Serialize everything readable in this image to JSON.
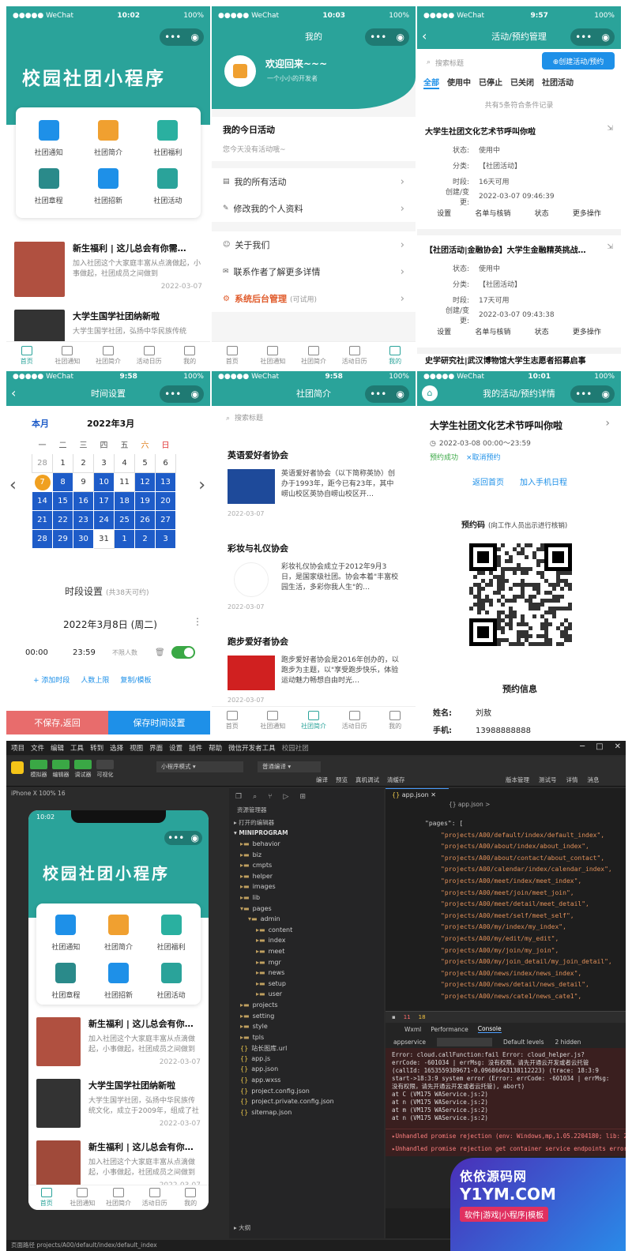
{
  "colors": {
    "teal": "#2aa39a",
    "blue": "#1e5cc8",
    "red": "#e05a5a"
  },
  "status": {
    "carrier": "●●●●● WeChat",
    "time1": "10:02",
    "time2": "10:03",
    "time3": "9:57",
    "time4": "9:58",
    "time5": "10:01",
    "battery": "100%"
  },
  "home": {
    "banner": "校园社团小程序",
    "grid": [
      {
        "label": "社团通知",
        "icon": "speaker-icon"
      },
      {
        "label": "社团简介",
        "icon": "book-icon"
      },
      {
        "label": "社团福利",
        "icon": "gift-icon"
      },
      {
        "label": "社团章程",
        "icon": "layers-icon"
      },
      {
        "label": "社团招新",
        "icon": "recruit-icon"
      },
      {
        "label": "社团活动",
        "icon": "flag-icon"
      }
    ],
    "news": [
      {
        "title": "新生福利 | 这儿总会有你需…",
        "desc": "加入社团这个大家庭丰富从点滴做起，小事做起，社团成员之间做到",
        "date": "2022-03-07"
      },
      {
        "title": "大学生国学社团纳新啦",
        "desc": "大学生国学社团，弘扬中华民族传统",
        "date": ""
      }
    ],
    "tabs": [
      "首页",
      "社团通知",
      "社团简介",
      "活动日历",
      "我的"
    ]
  },
  "me": {
    "title": "我的",
    "welcome": "欢迎回来~~~",
    "sub": "一个小小的开发者",
    "today_title": "我的今日活动",
    "today_empty": "您今天没有活动哦~",
    "menu1": [
      "我的所有活动",
      "修改我的个人资料"
    ],
    "menu2": [
      "关于我们",
      "联系作者了解更多详情"
    ],
    "admin": "系统后台管理",
    "admin_note": "(可试用)"
  },
  "manage": {
    "title": "活动/预约管理",
    "search": "搜索标题",
    "create": "⊕创建活动/预约",
    "filters": [
      "全部",
      "使用中",
      "已停止",
      "已关闭",
      "社团活动"
    ],
    "count": "共有5条符合条件记录",
    "cards": [
      {
        "title": "大学生社团文化艺术节呼叫你啦",
        "kv": [
          [
            "状态:",
            "使用中"
          ],
          [
            "分类:",
            "【社团活动】"
          ],
          [
            "时段:",
            "16天可用"
          ],
          [
            "创建/变更:",
            "2022-03-07 09:46:39"
          ]
        ]
      },
      {
        "title": "【社团活动|金融协会】大学生金融精英挑战…",
        "kv": [
          [
            "状态:",
            "使用中"
          ],
          [
            "分类:",
            "【社团活动】"
          ],
          [
            "时段:",
            "17天可用"
          ],
          [
            "创建/变更:",
            "2022-03-07 09:43:38"
          ]
        ]
      }
    ],
    "ops": [
      "设置",
      "名单与核销",
      "状态",
      "更多操作"
    ],
    "third": "史学研究社|武汉博物馆大学生志愿者招募启事"
  },
  "timeset": {
    "title": "时间设置",
    "month_tab": "本月",
    "month": "2022年3月",
    "week": [
      "一",
      "二",
      "三",
      "四",
      "五",
      "六",
      "日"
    ],
    "rows": [
      [
        "28",
        "1",
        "2",
        "3",
        "4",
        "5",
        "6"
      ],
      [
        "7",
        "8",
        "9",
        "10",
        "11",
        "12",
        "13"
      ],
      [
        "14",
        "15",
        "16",
        "17",
        "18",
        "19",
        "20"
      ],
      [
        "21",
        "22",
        "23",
        "24",
        "25",
        "26",
        "27"
      ],
      [
        "28",
        "29",
        "30",
        "31",
        "1",
        "2",
        "3"
      ]
    ],
    "period_title": "时段设置",
    "period_note": "(共38天可约)",
    "date": "2022年3月8日 (周二)",
    "start": "00:00",
    "end": "23:59",
    "limit": "不限人数",
    "actions": [
      "+ 添加时段",
      "人数上限",
      "复制/模板"
    ],
    "cancel": "不保存,返回",
    "save": "保存时间设置"
  },
  "clubs": {
    "title": "社团简介",
    "search": "搜索标题",
    "items": [
      {
        "name": "英语爱好者协会",
        "desc": "英语爱好者协会（以下简称英协）创办于1993年，距今已有23年，其中崂山校区英协自崂山校区开…",
        "date": "2022-03-07"
      },
      {
        "name": "彩妆与礼仪协会",
        "desc": "彩妆礼仪协会成立于2012年9月3日，是国家级社团。协会本着\"丰富校园生活，多彩你我人生\"的…",
        "date": "2022-03-07"
      },
      {
        "name": "跑步爱好者协会",
        "desc": "跑步爱好者协会是2016年创办的，以跑步为主题，以\"享受跑步快乐，体验运动魅力畅想自由时光…",
        "date": "2022-03-07"
      }
    ]
  },
  "detail": {
    "title": "我的活动/预约详情",
    "name": "大学生社团文化艺术节呼叫你啦",
    "time": "2022-03-08 00:00～23:59",
    "ok": "预约成功",
    "cancel": "×取消预约",
    "back": "返回首页",
    "cal": "加入手机日程",
    "code_label": "预约码",
    "code_note": "(向工作人员出示进行核销)",
    "info": "预约信息",
    "k1": "姓名:",
    "v1": "刘敖",
    "k2": "手机:",
    "v2": "13988888888"
  },
  "ide": {
    "menu": [
      "项目",
      "文件",
      "编辑",
      "工具",
      "转到",
      "选择",
      "视图",
      "界面",
      "设置",
      "插件",
      "帮助",
      "微信开发者工具"
    ],
    "project": "校园社团",
    "mode": "小程序模式",
    "compile": "普通编译",
    "toolbar": [
      "编译",
      "预览",
      "真机调试",
      "清缓存"
    ],
    "right_tools": [
      "版本管理",
      "测试号",
      "详情",
      "消息"
    ],
    "left_tools": [
      "模拟器",
      "编辑器",
      "调试器",
      "可视化"
    ],
    "device": "iPhone X 100% 16",
    "resource": "资源管理器",
    "open_editors": "打开的编辑器",
    "root": "MINIPROGRAM",
    "tree": [
      "behavior",
      "biz",
      "cmpts",
      "helper",
      "images",
      "lib",
      "pages",
      "admin",
      "content",
      "index",
      "meet",
      "mgr",
      "news",
      "setup",
      "user",
      "projects",
      "setting",
      "style",
      "tpls",
      "站长图库.url",
      "app.js",
      "app.json",
      "app.wxss",
      "project.config.json",
      "project.private.config.json",
      "sitemap.json"
    ],
    "file_tab": "app.json",
    "crumb": "{} app.json >",
    "code": [
      "\"pages\": [",
      "\"projects/A00/default/index/default_index\",",
      "\"projects/A00/about/index/about_index\",",
      "\"projects/A00/about/contact/about_contact\",",
      "\"projects/A00/calendar/index/calendar_index\",",
      "\"projects/A00/meet/index/meet_index\",",
      "\"projects/A00/meet/join/meet_join\",",
      "\"projects/A00/meet/detail/meet_detail\",",
      "\"projects/A00/meet/self/meet_self\",",
      "\"projects/A00/my/index/my_index\",",
      "\"projects/A00/my/edit/my_edit\",",
      "\"projects/A00/my/join/my_join\",",
      "\"projects/A00/my/join_detail/my_join_detail\",",
      "\"projects/A00/news/index/news_index\",",
      "\"projects/A00/news/detail/news_detail\",",
      "\"projects/A00/news/cate1/news_cate1\","
    ],
    "console_tabs": [
      "Wxml",
      "Performance",
      "Console"
    ],
    "console_filter": "appservice",
    "console_levels": "Default levels",
    "console_hidden": "2 hidden",
    "console_lines": [
      "Error: cloud.callFunction:fail Error: cloud_helper.js?",
      "errCode: -601034 | errMsg: 没有权限，请先开通云开发或者云托管",
      "(callId: 1653559389671-0.09686643138112223) (trace: 18:3:9",
      "start->18:3:9 system error (Error: errCode: -601034 | errMsg:",
      "没有权限，请先开通云开发或者云托管), abort)",
      "  at C (VM175 WAService.js:2)",
      "  at n (VM175 WAService.js:2)",
      "  at m (VM175 WAService.js:2)",
      "  at n (VM175 WAService.js:2)"
    ],
    "err1": "▸Unhandled promise rejection   (env: Windows,mp,1.05.2204180; lib: 2.24.3)",
    "err2": "▸Unhandled promise rejection get  container service endpoints errors: Error: errCode: -601034",
    "status_path": "页面路径  projects/A00/default/index/default_index",
    "errors": "11",
    "warnings": "18",
    "outline": "大纲",
    "sim": {
      "time": "10:02",
      "banner": "校园社团小程序",
      "news": [
        {
          "title": "新生福利 | 这儿总会有你需…",
          "desc": "加入社团这个大家庭丰富从点滴做起，小事做起，社团成员之间做到",
          "date": "2022-03-07"
        },
        {
          "title": "大学生国学社团纳新啦",
          "desc": "大学生国学社团，弘扬中华民族传统文化，成立于2009年，组成了社团",
          "date": "2022-03-07"
        },
        {
          "title": "新生福利 | 这儿总会有你需…",
          "desc": "加入社团这个大家庭丰富从点滴做起，小事做起，社团成员之间做到",
          "date": "2022-03-07"
        }
      ]
    }
  },
  "watermark": {
    "line1": "依依源码网",
    "line2": "Y1YM.COM",
    "line3": "软件|游戏|小程序|模板"
  }
}
